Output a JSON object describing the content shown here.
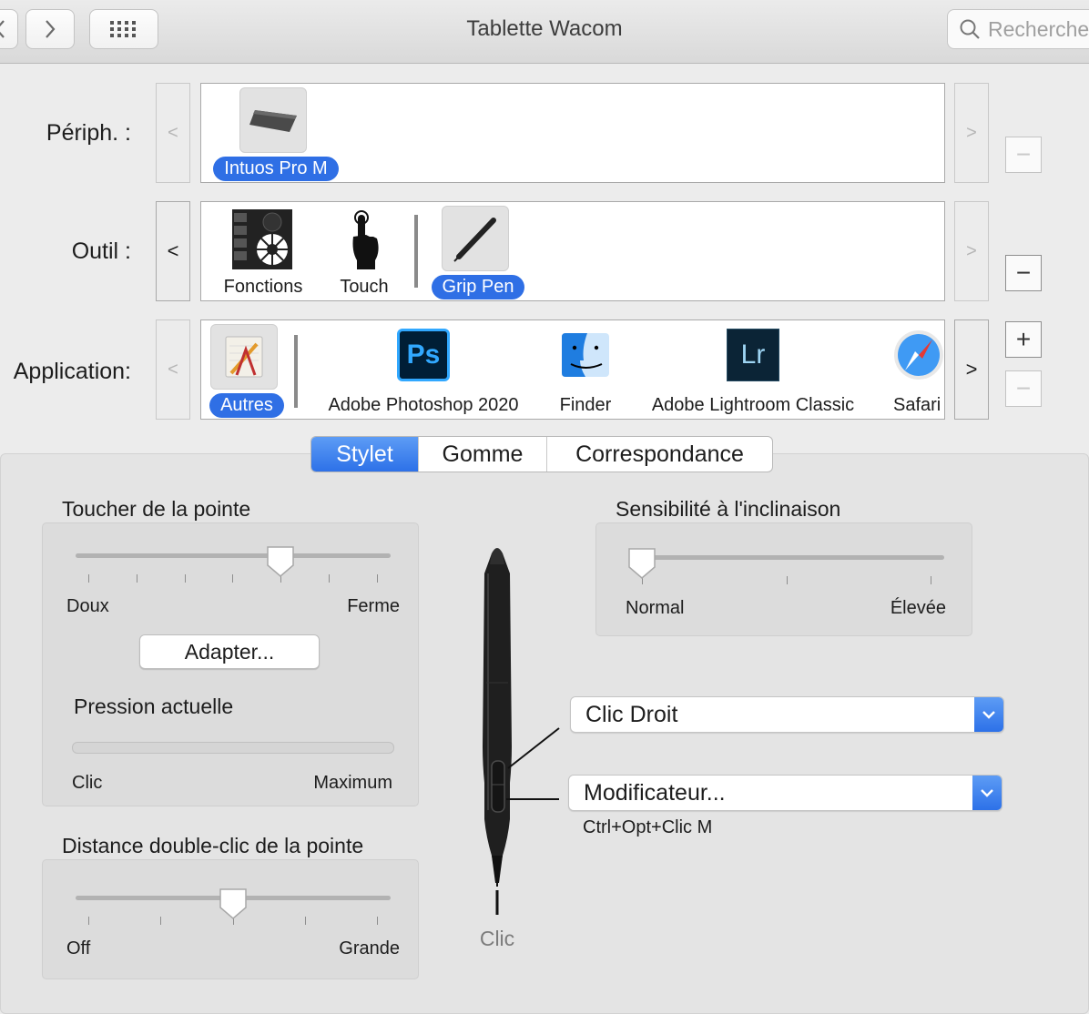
{
  "window": {
    "title": "Tablette Wacom"
  },
  "search": {
    "placeholder": "Rechercher"
  },
  "rows": {
    "device_label": "Périph. :",
    "tool_label": "Outil :",
    "app_label": "Application:"
  },
  "devices": [
    {
      "label": "Intuos Pro M",
      "selected": true
    }
  ],
  "tools": [
    {
      "label": "Fonctions",
      "selected": false
    },
    {
      "label": "Touch",
      "selected": false
    },
    {
      "label": "Grip Pen",
      "selected": true
    }
  ],
  "apps": [
    {
      "label": "Autres",
      "selected": true
    },
    {
      "label": "Adobe Photoshop 2020",
      "selected": false
    },
    {
      "label": "Finder",
      "selected": false
    },
    {
      "label": "Adobe Lightroom Classic",
      "selected": false
    },
    {
      "label": "Safari",
      "selected": false
    }
  ],
  "app_icons": {
    "photoshop": "Ps",
    "lightroom": "Lr"
  },
  "buttons": {
    "prev": "<",
    "next": ">",
    "minus": "−",
    "plus": "+"
  },
  "tabs": [
    {
      "label": "Stylet",
      "active": true
    },
    {
      "label": "Gomme",
      "active": false
    },
    {
      "label": "Correspondance",
      "active": false
    }
  ],
  "tip_feel": {
    "title": "Toucher de la pointe",
    "min_label": "Doux",
    "max_label": "Ferme",
    "value": 0.66,
    "ticks": 7,
    "button": "Adapter...",
    "pressure_title": "Pression actuelle",
    "pressure_min": "Clic",
    "pressure_max": "Maximum",
    "pressure_value": 0
  },
  "double_click": {
    "title": "Distance double-clic de la pointe",
    "min_label": "Off",
    "max_label": "Grande",
    "value": 0.5,
    "ticks": 5
  },
  "tilt": {
    "title": "Sensibilité à l'inclinaison",
    "min_label": "Normal",
    "max_label": "Élevée",
    "value": 0,
    "ticks": 3
  },
  "pen": {
    "upper_button": "Clic Droit",
    "lower_button": "Modificateur...",
    "lower_detail": "Ctrl+Opt+Clic M",
    "tip_label": "Clic"
  },
  "colors": {
    "accent": "#2f6fe5",
    "background": "#ececec"
  }
}
